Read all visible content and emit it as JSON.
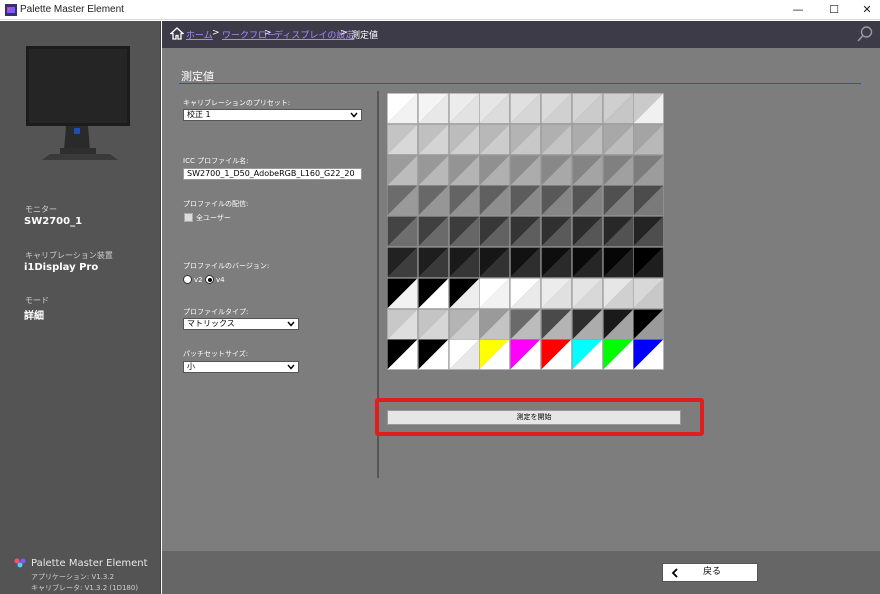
{
  "window": {
    "title": "Palette Master Element",
    "minimize": "—",
    "maximize": "☐",
    "close": "✕"
  },
  "sidebar": {
    "monitor_label": "モニター",
    "monitor_value": "SW2700_1",
    "device_label": "キャリブレーション装置",
    "device_value": "i1Display Pro",
    "mode_label": "モード",
    "mode_value": "詳細",
    "app_name": "Palette Master Element",
    "app_version": "アプリケーション: V1.3.2",
    "calibrator_version": "キャリブレータ: V1.3.2 (1D180)"
  },
  "breadcrumb": {
    "home": "ホーム",
    "workflow": "ワークフロー",
    "display_settings": "ディスプレイの設定",
    "current": "測定値",
    "sep": ">"
  },
  "main": {
    "heading": "測定値",
    "preset_label": "キャリブレーションのプリセット:",
    "preset_value": "校正 1",
    "icc_label": "ICC プロファイル名:",
    "icc_value": "SW2700_1_D50_AdobeRGB_L160_G22_20",
    "distribution_label": "プロファイルの配信:",
    "all_users_label": "全ユーザー",
    "version_label": "プロファイルのバージョン:",
    "v2_label": "v2",
    "v4_label": "v4",
    "type_label": "プロファイルタイプ:",
    "type_value": "マトリックス",
    "patch_label": "パッチセットサイズ:",
    "patch_value": "小",
    "start_button": "測定を開始"
  },
  "footer": {
    "back_button": "戻る"
  },
  "patches": {
    "rows": [
      [
        [
          "#ffffff",
          "#f2f2f2"
        ],
        [
          "#f4f4f4",
          "#e8e8e8"
        ],
        [
          "#ececec",
          "#e2e2e2"
        ],
        [
          "#e6e6e6",
          "#dcdcdc"
        ],
        [
          "#e0e0e0",
          "#d6d6d6"
        ],
        [
          "#dadada",
          "#d0d0d0"
        ],
        [
          "#d4d4d4",
          "#cbcbcb"
        ],
        [
          "#cfcfcf",
          "#c6c6c6"
        ],
        [
          "#cacaca",
          "#f0f0f0"
        ]
      ],
      [
        [
          "#c4c4c4",
          "#d8d8d8"
        ],
        [
          "#c0c0c0",
          "#d4d4d4"
        ],
        [
          "#bcbcbc",
          "#d0d0d0"
        ],
        [
          "#b8b8b8",
          "#cccccc"
        ],
        [
          "#b4b4b4",
          "#c8c8c8"
        ],
        [
          "#b0b0b0",
          "#c4c4c4"
        ],
        [
          "#acacac",
          "#c0c0c0"
        ],
        [
          "#a8a8a8",
          "#bcbcbc"
        ],
        [
          "#a4a4a4",
          "#b8b8b8"
        ]
      ],
      [
        [
          "#9c9c9c",
          "#bcbcbc"
        ],
        [
          "#989898",
          "#b8b8b8"
        ],
        [
          "#949494",
          "#b4b4b4"
        ],
        [
          "#909090",
          "#b0b0b0"
        ],
        [
          "#8c8c8c",
          "#acacac"
        ],
        [
          "#888888",
          "#a8a8a8"
        ],
        [
          "#848484",
          "#a4a4a4"
        ],
        [
          "#808080",
          "#a0a0a0"
        ],
        [
          "#7c7c7c",
          "#9c9c9c"
        ]
      ],
      [
        [
          "#6c6c6c",
          "#9a9a9a"
        ],
        [
          "#686868",
          "#969696"
        ],
        [
          "#646464",
          "#929292"
        ],
        [
          "#606060",
          "#8e8e8e"
        ],
        [
          "#5c5c5c",
          "#8a8a8a"
        ],
        [
          "#585858",
          "#868686"
        ],
        [
          "#545454",
          "#828282"
        ],
        [
          "#505050",
          "#7e7e7e"
        ],
        [
          "#4c4c4c",
          "#7a7a7a"
        ]
      ],
      [
        [
          "#444444",
          "#6e6e6e"
        ],
        [
          "#404040",
          "#6a6a6a"
        ],
        [
          "#3c3c3c",
          "#666666"
        ],
        [
          "#383838",
          "#626262"
        ],
        [
          "#343434",
          "#5e5e5e"
        ],
        [
          "#303030",
          "#5a5a5a"
        ],
        [
          "#2c2c2c",
          "#565656"
        ],
        [
          "#282828",
          "#525252"
        ],
        [
          "#242424",
          "#4e4e4e"
        ]
      ],
      [
        [
          "#222222",
          "#3e3e3e"
        ],
        [
          "#1e1e1e",
          "#3a3a3a"
        ],
        [
          "#1a1a1a",
          "#363636"
        ],
        [
          "#161616",
          "#323232"
        ],
        [
          "#121212",
          "#2e2e2e"
        ],
        [
          "#0e0e0e",
          "#2a2a2a"
        ],
        [
          "#0a0a0a",
          "#262626"
        ],
        [
          "#060606",
          "#222222"
        ],
        [
          "#000000",
          "#1e1e1e"
        ]
      ],
      [
        [
          "#000000",
          "#f2f2f2"
        ],
        [
          "#000000",
          "#ffffff"
        ],
        [
          "#000000",
          "#eeeeee"
        ],
        [
          "#ffffff",
          "#f2f2f2"
        ],
        [
          "#ffffff",
          "#eaeaea"
        ],
        [
          "#ececec",
          "#e0e0e0"
        ],
        [
          "#e4e4e4",
          "#d8d8d8"
        ],
        [
          "#e6e6e6",
          "#d0d0d0"
        ],
        [
          "#d8d8d8",
          "#c8c8c8"
        ]
      ],
      [
        [
          "#c8c8c8",
          "#dedede"
        ],
        [
          "#c4c4c4",
          "#d6d6d6"
        ],
        [
          "#b4b4b4",
          "#cccccc"
        ],
        [
          "#9a9a9a",
          "#c4c4c4"
        ],
        [
          "#6a6a6a",
          "#bcbcbc"
        ],
        [
          "#4a4a4a",
          "#b4b4b4"
        ],
        [
          "#2e2e2e",
          "#acacac"
        ],
        [
          "#1a1a1a",
          "#a4a4a4"
        ],
        [
          "#000000",
          "#9a9a9a"
        ]
      ],
      [
        [
          "#000000",
          "#ffffff"
        ],
        [
          "#000000",
          "#ffffff"
        ],
        [
          "#ffffff",
          "#e8e8e8"
        ],
        [
          "#ffff00",
          "#ffffff"
        ],
        [
          "#ff00ff",
          "#ffffff"
        ],
        [
          "#ff0000",
          "#ffffff"
        ],
        [
          "#00ffff",
          "#ffffff"
        ],
        [
          "#00ff00",
          "#ffffff"
        ],
        [
          "#0000ff",
          "#ffffff"
        ]
      ]
    ]
  }
}
